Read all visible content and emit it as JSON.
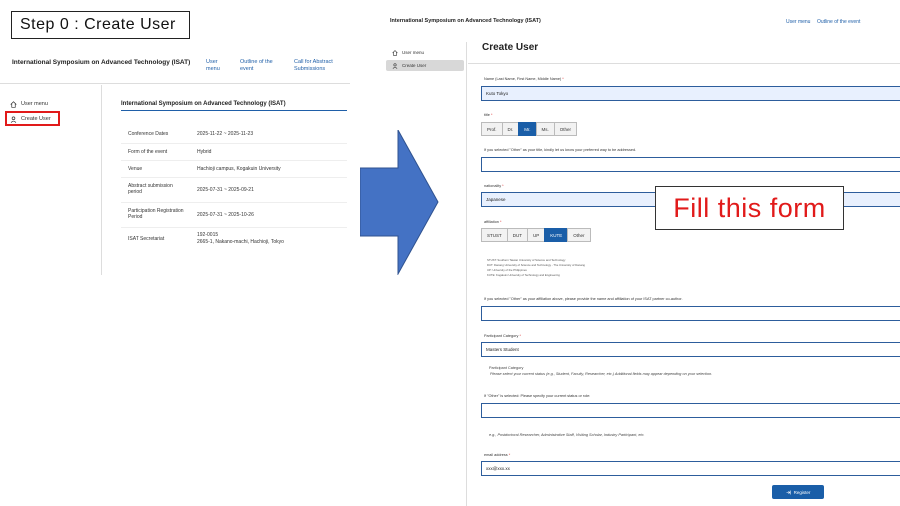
{
  "step_label": "Step 0 : Create User",
  "callout": "Fill this form",
  "left_screen": {
    "site_title": "International Symposium on Advanced Technology (ISAT)",
    "nav": [
      {
        "label": "User menu"
      },
      {
        "label": "Outline of the event"
      },
      {
        "label": "Call for Abstract Submissions"
      }
    ],
    "sidebar": [
      {
        "label": "User menu",
        "icon": "home-icon"
      },
      {
        "label": "Create User",
        "icon": "user-icon",
        "highlighted": true
      }
    ],
    "panel_title": "International Symposium on Advanced Technology (ISAT)",
    "rows": [
      {
        "key": "Conference Dates",
        "value": "2025-11-22 ~ 2025-11-23"
      },
      {
        "key": "Form of the event",
        "value": "Hybrid"
      },
      {
        "key": "Venue",
        "value": "Hachioji campus, Kogakuin University"
      },
      {
        "key": "Abstract submission period",
        "value": "2025-07-31 ~ 2025-09-21"
      },
      {
        "key": "Participation Registration Period",
        "value": "2025-07-31 ~ 2025-10-26"
      },
      {
        "key": "ISAT Secretariat",
        "value": "192-0015\n2665-1, Nakano-machi, Hachioji, Tokyo"
      }
    ],
    "highlight_color": "#e11a1a"
  },
  "right_screen": {
    "site_title": "International Symposium on Advanced Technology (ISAT)",
    "nav": [
      {
        "label": "User menu"
      },
      {
        "label": "Outline of the event"
      }
    ],
    "sidebar": [
      {
        "label": "User menu",
        "icon": "home-icon"
      },
      {
        "label": "Create User",
        "icon": "user-icon",
        "active": true
      }
    ],
    "form_title": "Create User",
    "name": {
      "label": "Name (Last Name, First Name, Middle Name)",
      "required": "*",
      "value": "Kuto Tokyo"
    },
    "title": {
      "label": "title",
      "required": "*",
      "options": [
        "Prof.",
        "Dr.",
        "Mr.",
        "Ms.",
        "Other"
      ],
      "selected": "Mr."
    },
    "title_other": {
      "label": "If you selected \"Other\" as your title, kindly let us know your preferred way to be addressed.",
      "value": ""
    },
    "nationality": {
      "label": "nationality",
      "required": "*",
      "value": "Japanese"
    },
    "affiliation": {
      "label": "affiliation",
      "required": "*",
      "options": [
        "STUST",
        "DUT",
        "UP",
        "KUTE",
        "Other"
      ],
      "selected": "KUTE",
      "notes": [
        "STUST: Southern Taiwan University of Science and Technology",
        "DUT: Danang University of Science and Technology - The University of Danang",
        "UP: University of the Philippines",
        "KUTE: Kogakuin University of Technology and Engineering"
      ]
    },
    "affiliation_other": {
      "label": "If you selected \"Other\" as your affiliation above, please provide the name and affiliation of your ISAT partner co-author.",
      "value": ""
    },
    "participant_category": {
      "label": "Participant Category",
      "required": "*",
      "value": "Masters Student",
      "note_title": "Participant Category",
      "note_text": "Please select your current status (e.g., Student, Faculty, Researcher, etc.) Additional fields may appear depending on your selection."
    },
    "status_other": {
      "label": "If \"Other\" is selected: Please specify your current status or role:",
      "value": "",
      "example": "e.g., Postdoctoral Researcher, Administrative Staff, Visiting Scholar, Industry Participant, etc."
    },
    "email": {
      "label": "email address",
      "required": "*",
      "value": "xxx@xxx.xx"
    },
    "register_label": "Register",
    "accent_color": "#1a5ea8"
  }
}
